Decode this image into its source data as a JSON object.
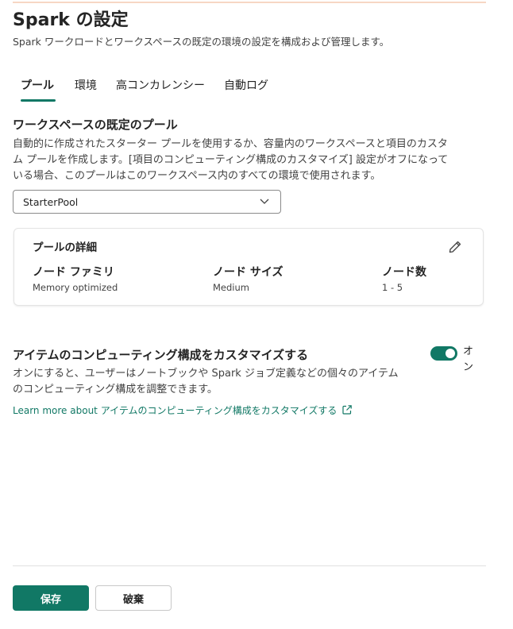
{
  "header": {
    "title": "Spark の設定",
    "subtitle": "Spark ワークロードとワークスペースの既定の環境の設定を構成および管理します。"
  },
  "tabs": [
    {
      "label": "プール",
      "active": true
    },
    {
      "label": "環境",
      "active": false
    },
    {
      "label": "高コンカレンシー",
      "active": false
    },
    {
      "label": "自動ログ",
      "active": false
    }
  ],
  "default_pool": {
    "title": "ワークスペースの既定のプール",
    "description_lines": [
      "自動的に作成されたスターター プールを使用するか、容量内のワークスペースと項目のカスタ",
      "ム プールを作成します。[項目のコンピューティング構成のカスタマイズ] 設定がオフになって",
      "いる場合、このプールはこのワークスペース内のすべての環境で使用されます。"
    ],
    "selected_pool": "StarterPool"
  },
  "pool_details": {
    "title": "プールの詳細",
    "columns": [
      {
        "label": "ノード ファミリ",
        "value": "Memory optimized"
      },
      {
        "label": "ノード サイズ",
        "value": "Medium"
      },
      {
        "label": "ノード数",
        "value": "1 - 5"
      }
    ]
  },
  "customize": {
    "title": "アイテムのコンピューティング構成をカスタマイズする",
    "description_lines": [
      "オンにすると、ユーザーはノートブックや Spark ジョブ定義などの個々のアイテム",
      "のコンピューティング構成を調整できます。"
    ],
    "toggle_on": true,
    "toggle_label": "オン",
    "learn_more_link": "Learn more about アイテムのコンピューティング構成をカスタマイズする"
  },
  "footer": {
    "save_label": "保存",
    "discard_label": "破棄"
  },
  "colors": {
    "accent": "#117865",
    "top_border": "#f7d7c4"
  },
  "icons": {
    "dropdown": "chevron-down-icon",
    "edit": "pencil-icon",
    "external": "external-link-icon"
  }
}
